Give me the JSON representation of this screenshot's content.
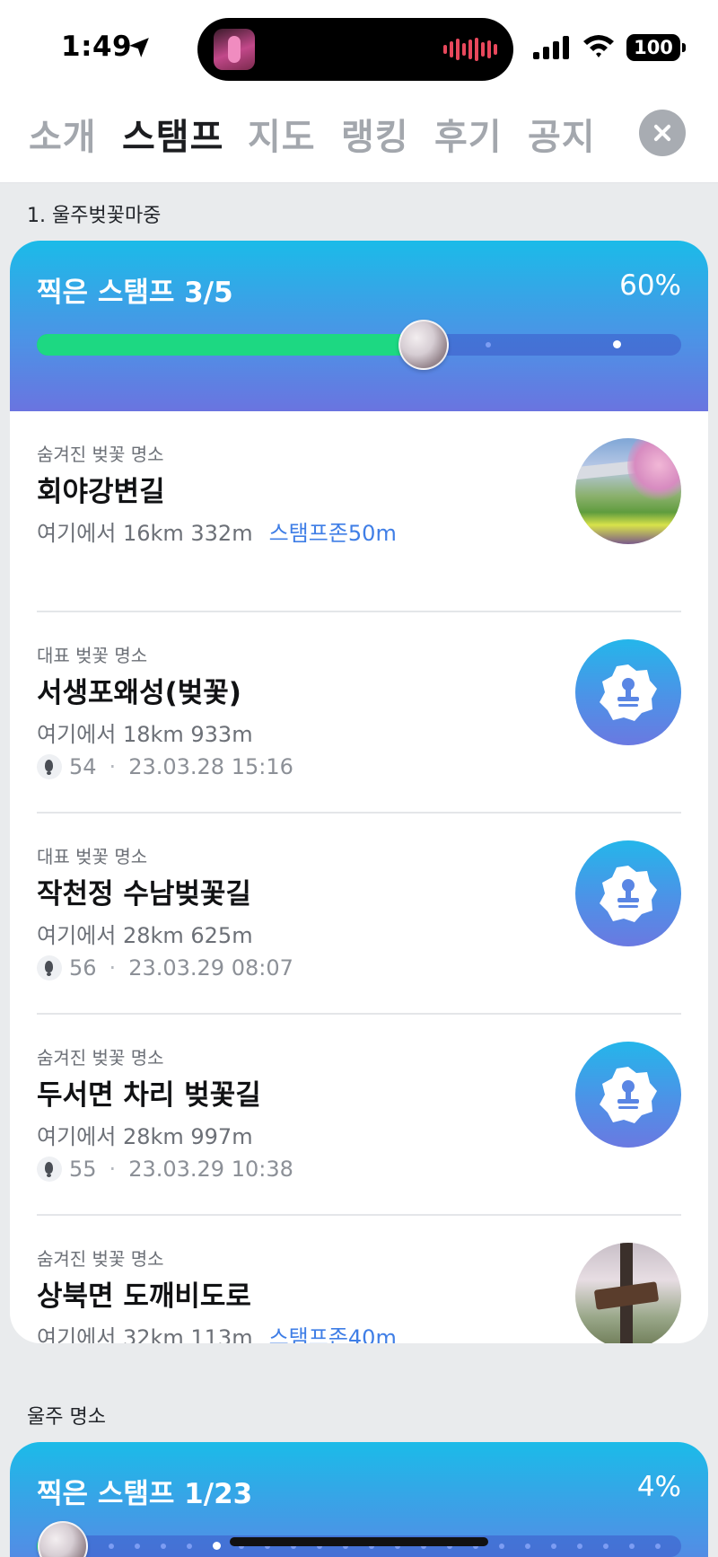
{
  "status": {
    "time": "1:49",
    "battery": "100"
  },
  "tabs": [
    "소개",
    "스탬프",
    "지도",
    "랭킹",
    "후기",
    "공지"
  ],
  "active_tab": "스탬프",
  "sections": [
    {
      "title": "1. 울주벚꽃마중",
      "collected": "찍은 스탬프 3/5",
      "percent": "60%",
      "progress": 0.6,
      "items": [
        {
          "category": "숨겨진 벚꽃 명소",
          "name": "회야강변길",
          "distance": "여기에서 16km 332m",
          "zone": "스탬프존50m",
          "thumb": "bridge-photo"
        },
        {
          "category": "대표 벚꽃 명소",
          "name": "서생포왜성(벚꽃)",
          "distance": "여기에서 18km 933m",
          "steps": "54",
          "datetime": "23.03.28 15:16",
          "thumb": "stamp-icon"
        },
        {
          "category": "대표 벚꽃 명소",
          "name": "작천정 수남벚꽃길",
          "distance": "여기에서 28km 625m",
          "steps": "56",
          "datetime": "23.03.29 08:07",
          "thumb": "stamp-icon"
        },
        {
          "category": "숨겨진 벚꽃 명소",
          "name": "두서면 차리 벚꽃길",
          "distance": "여기에서 28km 997m",
          "steps": "55",
          "datetime": "23.03.29 10:38",
          "thumb": "stamp-icon"
        },
        {
          "category": "숨겨진 벚꽃 명소",
          "name": "상북면 도깨비도로",
          "distance": "여기에서 32km 113m",
          "zone": "스탬프존40m",
          "thumb": "tree-photo"
        }
      ]
    },
    {
      "title": "울주 명소",
      "collected": "찍은 스탬프 1/23",
      "percent": "4%",
      "progress": 0.04
    }
  ],
  "colors": {
    "accent_blue": "#3f7ee6",
    "progress_green": "#1dd882",
    "header_top": "#1bbbe8",
    "header_bottom": "#6a74e0"
  }
}
